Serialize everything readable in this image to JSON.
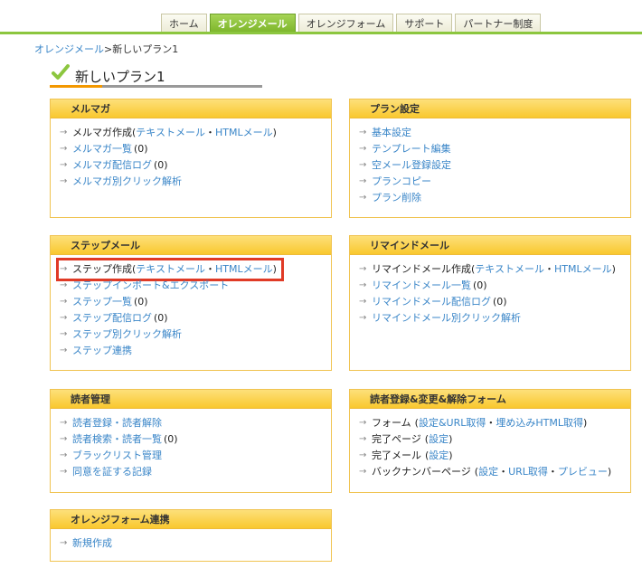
{
  "nav": {
    "tabs": [
      {
        "label": "ホーム",
        "active": false
      },
      {
        "label": "オレンジメール",
        "active": true
      },
      {
        "label": "オレンジフォーム",
        "active": false
      },
      {
        "label": "サポート",
        "active": false
      },
      {
        "label": "パートナー制度",
        "active": false
      }
    ]
  },
  "breadcrumb": {
    "parent": "オレンジメール",
    "separator": ">",
    "current": "新しいプラン1"
  },
  "page": {
    "title": "新しいプラン1"
  },
  "icons": {
    "arrow": "→",
    "check": "check-icon"
  },
  "colors": {
    "accent_green": "#8cc63f",
    "panel_header": "#f9c82e",
    "link": "#3a86c8",
    "highlight": "#e03a26"
  },
  "panels": {
    "merumaga": {
      "title": "メルマガ",
      "create_label": "メルマガ作成",
      "text_mail": "テキストメール",
      "dot": "・",
      "html_mail": "HTMLメール",
      "open_paren": "(",
      "close_paren": ")",
      "list": "メルマガ一覧",
      "list_count": "(0)",
      "log": "メルマガ配信ログ",
      "log_count": "(0)",
      "click": "メルマガ別クリック解析"
    },
    "plan": {
      "title": "プラン設定",
      "items": [
        "基本設定",
        "テンプレート編集",
        "空メール登録設定",
        "プランコピー",
        "プラン削除"
      ]
    },
    "step": {
      "title": "ステップメール",
      "create_label": "ステップ作成",
      "text_mail": "テキストメール",
      "dot": "・",
      "html_mail": "HTMLメール",
      "open_paren": "(",
      "close_paren": ")",
      "import_export": "ステップインポート&エクスポート",
      "list": "ステップ一覧",
      "list_count": "(0)",
      "log": "ステップ配信ログ",
      "log_count": "(0)",
      "click": "ステップ別クリック解析",
      "link": "ステップ連携"
    },
    "remind": {
      "title": "リマインドメール",
      "create_label": "リマインドメール作成",
      "text_mail": "テキストメール",
      "dot": "・",
      "html_mail": "HTMLメール",
      "open_paren": "(",
      "close_paren": ")",
      "list": "リマインドメール一覧",
      "list_count": "(0)",
      "log": "リマインドメール配信ログ",
      "log_count": "(0)",
      "click": "リマインドメール別クリック解析"
    },
    "reader": {
      "title": "読者管理",
      "items": [
        "読者登録・読者解除",
        "読者検索・読者一覧",
        "ブラックリスト管理",
        "同意を証する記録"
      ],
      "search_count": "(0)"
    },
    "form": {
      "title": "読者登録&変更&解除フォーム",
      "form_label": "フォーム",
      "open_paren": "(",
      "close_paren": ")",
      "dot": "・",
      "form_links": [
        "設定&URL取得",
        "埋め込みHTML取得"
      ],
      "complete_page": "完了ページ",
      "complete_mail": "完了メール",
      "setting": "設定",
      "backnumber": "バックナンバーページ",
      "backnumber_links": [
        "設定",
        "URL取得",
        "プレビュー"
      ]
    },
    "orange_form": {
      "title": "オレンジフォーム連携",
      "new": "新規作成"
    }
  }
}
